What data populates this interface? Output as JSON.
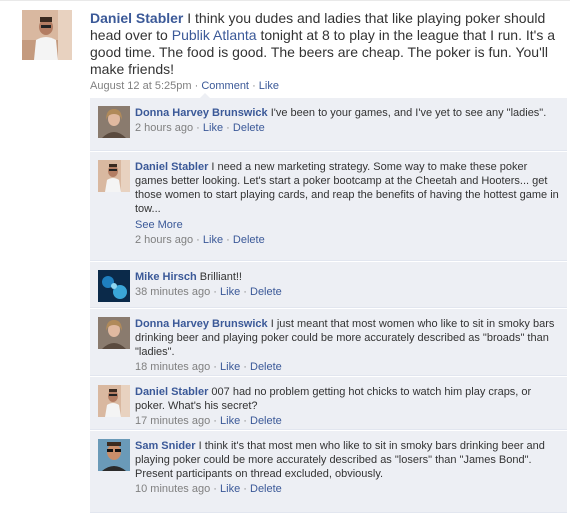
{
  "story": {
    "author": "Daniel Stabler",
    "text_before_link": " I think you dudes and ladies that like playing poker should head over to ",
    "link_text": "Publik Atlanta",
    "text_after_link": " tonight at 8 to play in the league that I run. It's a good time. The food is good. The beers are cheap. The poker is fun. You'll make friends!",
    "timestamp": "August 12 at 5:25pm",
    "separator": "·",
    "comment_label": "Comment",
    "like_label": "Like"
  },
  "comments": [
    {
      "author": "Donna Harvey Brunswick",
      "text": " I've been to your games, and I've yet to see any \"ladies\".",
      "time": "2 hours ago",
      "like": "Like",
      "delete": "Delete",
      "avatar_icon": "woman-photo",
      "see_more": ""
    },
    {
      "author": "Daniel Stabler",
      "text": " I need a new marketing strategy. Some way to make these poker games better looking. Let's start a poker bootcamp at the Cheetah and Hooters... get those women to start playing cards, and reap the benefits of having the hottest game in tow...",
      "time": "2 hours ago",
      "like": "Like",
      "delete": "Delete",
      "avatar_icon": "man-photo",
      "see_more": "See More"
    },
    {
      "author": "Mike Hirsch",
      "text": " Brilliant!!",
      "time": "38 minutes ago",
      "like": "Like",
      "delete": "Delete",
      "avatar_icon": "dark-blue-photo",
      "see_more": ""
    },
    {
      "author": "Donna Harvey Brunswick",
      "text": " I just meant that most women who like to sit in smoky bars drinking beer and playing poker could be more accurately described as \"broads\" than \"ladies\".",
      "time": "18 minutes ago",
      "like": "Like",
      "delete": "Delete",
      "avatar_icon": "woman-photo",
      "see_more": ""
    },
    {
      "author": "Daniel Stabler",
      "text": " 007 had no problem getting hot chicks to watch him play craps, or poker. What's his secret?",
      "time": "17 minutes ago",
      "like": "Like",
      "delete": "Delete",
      "avatar_icon": "man-photo",
      "see_more": ""
    },
    {
      "author": "Sam Snider",
      "text": " I think it's that most men who like to sit in smoky bars drinking beer and playing poker could be more accurately described as \"losers\" than \"James Bond\". Present participants on thread excluded, obviously.",
      "time": "10 minutes ago",
      "like": "Like",
      "delete": "Delete",
      "avatar_icon": "man-sunglasses-photo",
      "see_more": ""
    }
  ],
  "colors": {
    "link": "#3b5998",
    "comment_bg": "#edeff4",
    "meta": "#808080"
  }
}
